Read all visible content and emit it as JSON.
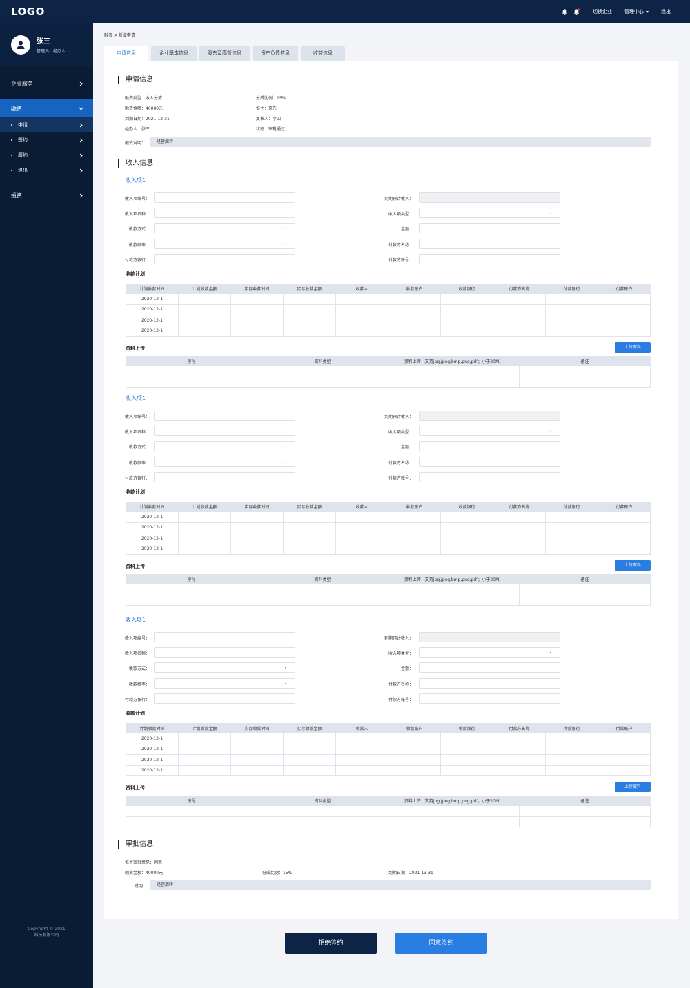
{
  "header": {
    "logo": "LOGO",
    "switch_company": "切换企业",
    "admin_center": "管理中心",
    "logout": "退出",
    "icons": [
      "bell-icon",
      "notification-bell-icon"
    ]
  },
  "user": {
    "name": "张三",
    "role": "管理员、经办人"
  },
  "sidebar": {
    "items": [
      {
        "label": "企业服务"
      },
      {
        "label": "融资"
      },
      {
        "label": "投资"
      }
    ],
    "sub_items": [
      {
        "label": "申请"
      },
      {
        "label": "签约"
      },
      {
        "label": "履约"
      },
      {
        "label": "退出"
      }
    ],
    "copyright_line1": "Copyright © 2021",
    "copyright_line2": "科技有限公司"
  },
  "breadcrumb": "融资 > 新增申请",
  "tabs": [
    {
      "label": "申请信息"
    },
    {
      "label": "企业基本信息"
    },
    {
      "label": "股东及高管信息"
    },
    {
      "label": "资产负债信息"
    },
    {
      "label": "收益信息"
    }
  ],
  "apply": {
    "title": "申请信息",
    "financing_type": "融资类型：收入分成",
    "share_ratio": "分成比例：15%",
    "amount": "融资金额：40000元",
    "sponsor": "推主：京东",
    "due_date": "到期日期：2021-12-31",
    "reviewer": "复核人：李四",
    "handler": "经办人：张三",
    "status": "状态：审批通过",
    "note_label": "融资说明：",
    "note_value": "经营周转"
  },
  "income": {
    "title": "收入信息",
    "item_title": "收入项1",
    "labels": {
      "item_no": "收入项编号：",
      "item_name": "收入项名称：",
      "collect_method": "收款方式：",
      "collect_freq": "收款频率：",
      "payer_bank": "付款方银行：",
      "expected_income": "到期预计收入：",
      "item_type": "收入项类型：",
      "amount": "金额：",
      "payer_name": "付款方名称：",
      "payer_account": "付款方账号："
    },
    "plan_title": "收款计划",
    "plan_headers": [
      "计划收款时间",
      "计划收款金额",
      "实际收款时间",
      "实际收款金额",
      "收款人",
      "收款账户",
      "收款银行",
      "付款方名称",
      "付款银行",
      "付款账户"
    ],
    "plan_dates": [
      "2020-12-1",
      "2020-12-1",
      "2020-12-1",
      "2020-12-1"
    ],
    "upload_title": "资料上传",
    "upload_button": "上传资料",
    "upload_headers": [
      "序号",
      "资料类型",
      "资料上传（支持jpg,jpeg,bmp,png,pdf；小于20M）",
      "备注"
    ]
  },
  "approval": {
    "title": "审批信息",
    "opinion": "推主审批意见：同意",
    "amount": "融资金额：40000元",
    "share_ratio": "分成比例：15%",
    "due_date": "到期日期：2021-13-31",
    "note_label": "说明：",
    "note_value": "经营周转"
  },
  "actions": {
    "reject": "拒绝签约",
    "agree": "同意签约"
  },
  "colors": {
    "navy": "#0d2446",
    "sidebar": "#0a1c33",
    "accent": "#2a7de1",
    "link": "#1e73d9"
  }
}
